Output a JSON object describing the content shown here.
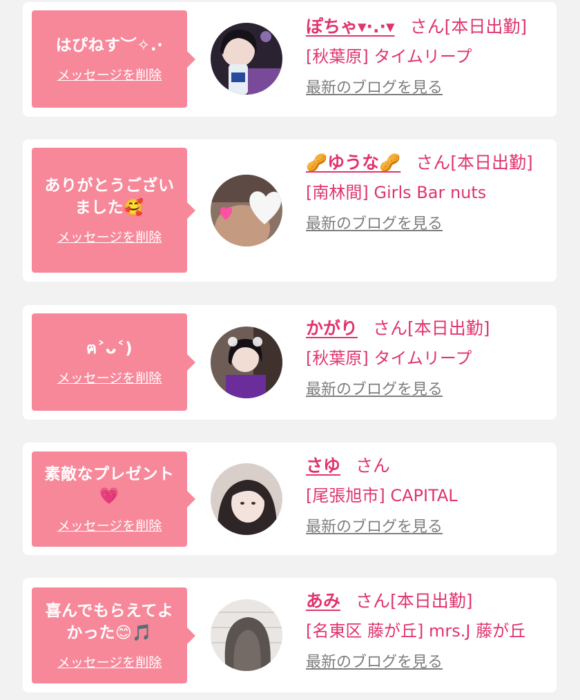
{
  "messages": [
    {
      "message": "はぴねす︶✧.·",
      "delete_label": "メッセージを削除",
      "cast_name": "ぽちゃ▾·.·▾",
      "honorific": "さん",
      "status": "[本日出勤]",
      "shop": "[秋葉原] タイムリープ",
      "blog_label": "最新のブログを見る",
      "avatar_icon": "girl-photo-avatar"
    },
    {
      "message": "ありがとうござい\nました🥰",
      "delete_label": "メッセージを削除",
      "cast_name": "🥜ゆうな🥜",
      "honorific": "さん",
      "status": "[本日出勤]",
      "shop": "[南林間] Girls Bar nuts",
      "blog_label": "最新のブログを見る",
      "avatar_icon": "heart-covered-photo-avatar"
    },
    {
      "message": "ฅ˃ᴗ˂)",
      "delete_label": "メッセージを削除",
      "cast_name": "かがり",
      "honorific": "さん",
      "status": "[本日出勤]",
      "shop": "[秋葉原] タイムリープ",
      "blog_label": "最新のブログを見る",
      "avatar_icon": "girl-photo-avatar"
    },
    {
      "message": "素敵なプレゼント\n💗",
      "delete_label": "メッセージを削除",
      "cast_name": "さゆ",
      "honorific": "さん",
      "status": "",
      "shop": "[尾張旭市] CAPITAL",
      "blog_label": "最新のブログを見る",
      "avatar_icon": "girl-photo-avatar"
    },
    {
      "message": "喜んでもらえてよ\nかった😊🎵",
      "delete_label": "メッセージを削除",
      "cast_name": "あみ",
      "honorific": "さん",
      "status": "[本日出勤]",
      "shop": "[名東区 藤が丘] mrs.J 藤が丘",
      "blog_label": "最新のブログを見る",
      "avatar_icon": "hair-photo-avatar"
    }
  ],
  "colors": {
    "page_background": "#f2f2f2",
    "bubble": "#f7889a",
    "accent_pink": "#e0336e",
    "link_gray": "#7d7d7d"
  }
}
